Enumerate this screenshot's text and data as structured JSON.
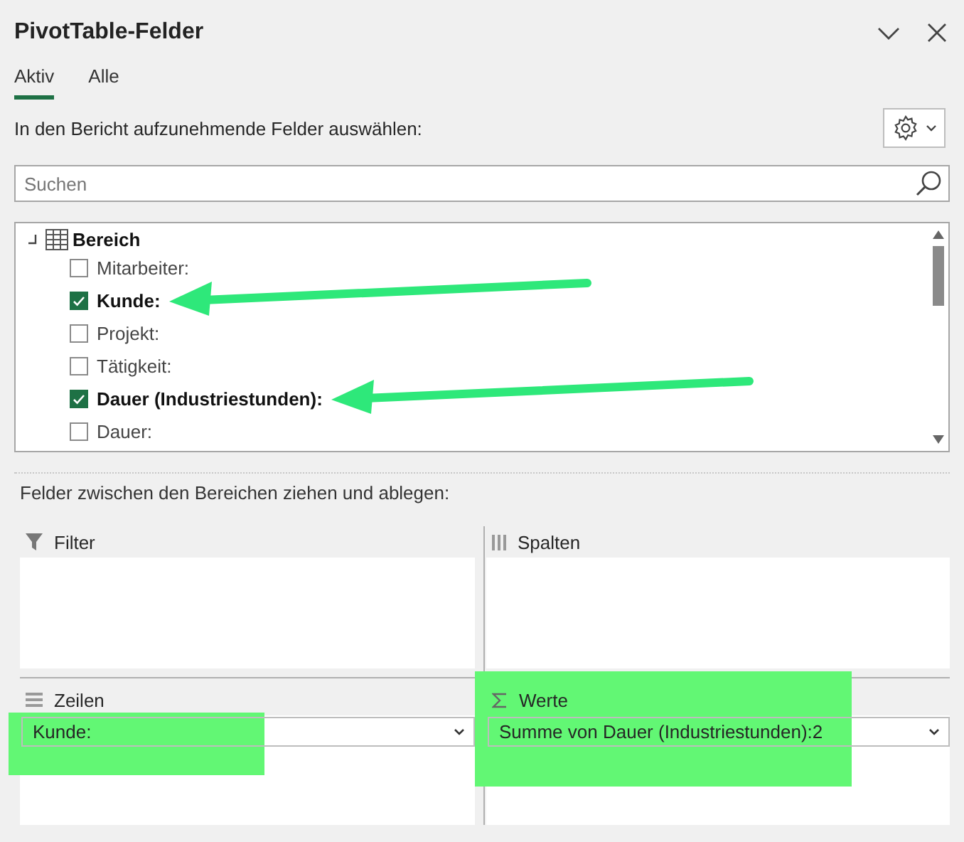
{
  "window": {
    "title": "PivotTable-Felder"
  },
  "tabs": [
    {
      "label": "Aktiv",
      "selected": true
    },
    {
      "label": "Alle",
      "selected": false
    }
  ],
  "instruction": "In den Bericht aufzunehmende Felder auswählen:",
  "search": {
    "placeholder": "Suchen"
  },
  "field_list": {
    "table": "Bereich",
    "expanded": true,
    "fields": [
      {
        "label": "Mitarbeiter:",
        "checked": false,
        "highlighted": false
      },
      {
        "label": "Kunde:",
        "checked": true,
        "highlighted": true
      },
      {
        "label": "Projekt:",
        "checked": false,
        "highlighted": false
      },
      {
        "label": "Tätigkeit:",
        "checked": false,
        "highlighted": false
      },
      {
        "label": "Dauer (Industriestunden):",
        "checked": true,
        "highlighted": true
      },
      {
        "label": "Dauer:",
        "checked": false,
        "highlighted": false
      }
    ]
  },
  "areas_hint": "Felder zwischen den Bereichen ziehen und ablegen:",
  "areas": [
    {
      "kind": "filter",
      "title": "Filter"
    },
    {
      "kind": "columns",
      "title": "Spalten"
    },
    {
      "kind": "rows",
      "title": "Zeilen",
      "items": [
        {
          "label": "Kunde:",
          "highlighted": true
        }
      ]
    },
    {
      "kind": "values",
      "title": "Werte",
      "items": [
        {
          "label": "Summe von Dauer (Industriestunden):2",
          "highlighted": true
        }
      ]
    }
  ]
}
